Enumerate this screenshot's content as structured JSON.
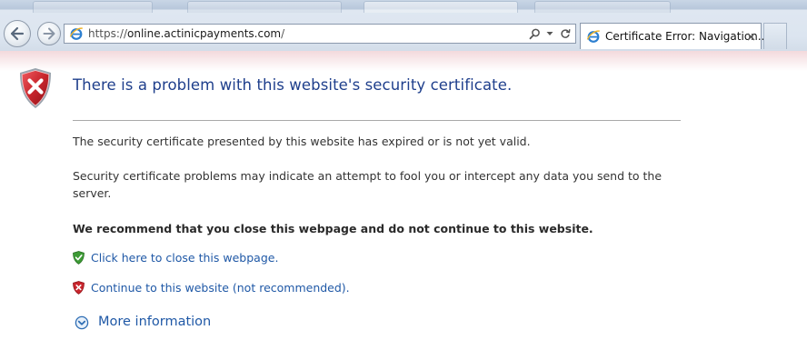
{
  "browser": {
    "address_bar": {
      "url_prefix": "https://",
      "url_host": "online.actinicpayments.com",
      "url_suffix": "/"
    },
    "active_tab": {
      "title": "Certificate Error: Navigation..."
    },
    "icons": {
      "back": "back-arrow-icon",
      "forward": "forward-arrow-icon",
      "search": "search-icon",
      "dropdown": "dropdown-arrow-icon",
      "refresh": "refresh-icon",
      "close": "close-icon",
      "page": "internet-explorer-icon"
    }
  },
  "page": {
    "title": "There is a problem with this website's security certificate.",
    "paragraph1": "The security certificate presented by this website has expired or is not yet valid.",
    "paragraph2": "Security certificate problems may indicate an attempt to fool you or intercept any data you send to the server.",
    "recommendation": "We recommend that you close this webpage and do not continue to this website.",
    "actions": {
      "close_link": "Click here to close this webpage.",
      "continue_link": "Continue to this website (not recommended)."
    },
    "more_info": "More information"
  },
  "colors": {
    "title": "#1f3f8c",
    "link": "#1f58a6",
    "body_text": "#333333",
    "error_red": "#c8252c",
    "safe_green": "#3d9a35",
    "rule": "#a9a9a9"
  }
}
